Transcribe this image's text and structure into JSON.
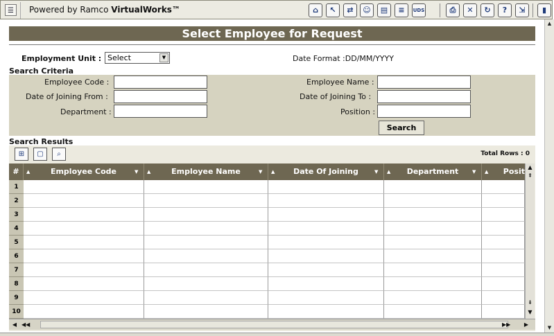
{
  "app": {
    "menu_icon": "menu-tree-icon",
    "brand_prefix": "Powered by Ramco ",
    "brand_name": "VirtualWorks™",
    "toolbar_icons": [
      "home-icon",
      "help-cursor-icon",
      "sync-icon",
      "users-icon",
      "document-icon",
      "list-icon",
      "uds-icon",
      "print-icon",
      "close-icon",
      "refresh-icon",
      "help-icon",
      "export-icon",
      "exit-icon"
    ],
    "uds_label": "UDS"
  },
  "page": {
    "title": "Select Employee for Request",
    "employment_unit_label": "Employment Unit :",
    "employment_unit_value": "Select",
    "date_format": "Date Format :DD/MM/YYYY",
    "search_criteria_heading": "Search Criteria",
    "search_results_heading": "Search Results"
  },
  "criteria": {
    "employee_code_label": "Employee Code :",
    "employee_code_value": "",
    "employee_name_label": "Employee Name :",
    "employee_name_value": "",
    "doj_from_label": "Date of Joining From :",
    "doj_from_value": "",
    "doj_to_label": "Date of Joining To :",
    "doj_to_value": "",
    "department_label": "Department :",
    "department_value": "",
    "position_label": "Position :",
    "position_value": "",
    "search_button": "Search"
  },
  "results": {
    "total_rows": "Total Rows :  0",
    "row_number_header": "#",
    "columns": [
      "Employee Code",
      "Employee Name",
      "Date Of Joining",
      "Department",
      "Posit"
    ],
    "row_numbers": [
      "1",
      "2",
      "3",
      "4",
      "5",
      "6",
      "7",
      "8",
      "9",
      "10"
    ]
  }
}
